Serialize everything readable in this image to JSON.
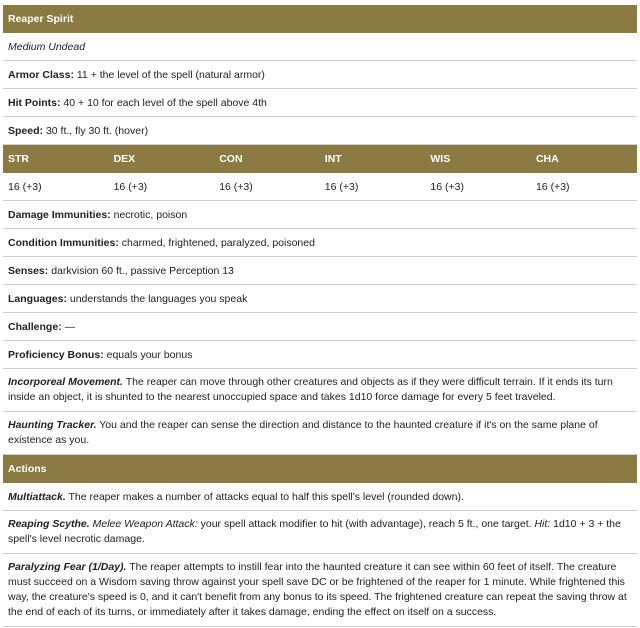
{
  "title": "Reaper Spirit",
  "type": "Medium Undead",
  "armor_class": {
    "label": "Armor Class:",
    "value": "11 + the level of the spell (natural armor)"
  },
  "hit_points": {
    "label": "Hit Points:",
    "value": "40 + 10 for each level of the spell above 4th"
  },
  "speed": {
    "label": "Speed:",
    "value": "30 ft., fly 30 ft. (hover)"
  },
  "abilities": [
    {
      "name": "STR",
      "score": "16 (+3)"
    },
    {
      "name": "DEX",
      "score": "16 (+3)"
    },
    {
      "name": "CON",
      "score": "16 (+3)"
    },
    {
      "name": "INT",
      "score": "16 (+3)"
    },
    {
      "name": "WIS",
      "score": "16 (+3)"
    },
    {
      "name": "CHA",
      "score": "16 (+3)"
    }
  ],
  "damage_immunities": {
    "label": "Damage Immunities:",
    "value": "necrotic, poison"
  },
  "condition_immunities": {
    "label": "Condition Immunities:",
    "value": "charmed, frightened, paralyzed, poisoned"
  },
  "senses": {
    "label": "Senses:",
    "value": "darkvision 60 ft., passive Perception 13"
  },
  "languages": {
    "label": "Languages:",
    "value": "understands the languages you speak"
  },
  "challenge": {
    "label": "Challenge:",
    "value": "—"
  },
  "proficiency": {
    "label": "Proficiency Bonus:",
    "value": "equals your bonus"
  },
  "traits": [
    {
      "name": "Incorporeal Movement.",
      "text": "The reaper can move through other creatures and objects as if they were difficult terrain. If it ends its turn inside an object, it is shunted to the nearest unoccupied space and takes 1d10 force damage for every 5 feet traveled."
    },
    {
      "name": "Haunting Tracker.",
      "text": "You and the reaper can sense the direction and distance to the haunted creature if it's on the same plane of existence as you."
    }
  ],
  "actions_heading": "Actions",
  "multiattack": {
    "name": "Multiattack.",
    "text": "The reaper makes a number of attacks equal to half this spell's level (rounded down)."
  },
  "reaping_scythe": {
    "name": "Reaping Scythe.",
    "attack_type": "Melee Weapon Attack:",
    "text1": "your spell attack modifier to hit (with advantage), reach 5 ft., one target.",
    "hit_label": "Hit:",
    "text2": "1d10 + 3 + the spell's level necrotic damage."
  },
  "paralyzing_fear": {
    "name": "Paralyzing Fear (1/Day).",
    "text": "The reaper attempts to instill fear into the haunted creature it can see within 60 feet of itself. The creature must succeed on a Wisdom saving throw against your spell save DC or be frightened of the reaper for 1 minute. While frightened this way, the creature's speed is 0, and it can't benefit from any bonus to its speed. The frightened creature can repeat the saving throw at the end of each of its turns, or immediately after it takes damage, ending the effect on itself on a success."
  }
}
